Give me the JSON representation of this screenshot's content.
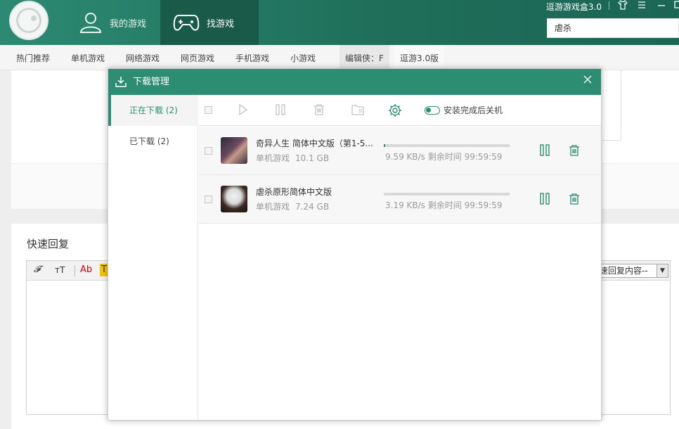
{
  "header": {
    "tabs": [
      {
        "label": "我的游戏",
        "icon": "user-icon"
      },
      {
        "label": "找游戏",
        "icon": "gamepad-icon"
      }
    ],
    "brand": "逗游游戏盒3.0",
    "search_value": "虐杀"
  },
  "subnav": {
    "items": [
      "热门推荐",
      "单机游戏",
      "网络游戏",
      "网页游戏",
      "手机游戏",
      "小游戏",
      "编辑侠：F",
      "逗游3.0版"
    ]
  },
  "page": {
    "quick_reply_title": "快速回复",
    "reply_select": "速回复内容--",
    "editor_buttons": [
      "𝓕",
      "ᴛT",
      "Ab",
      "T"
    ]
  },
  "dialog": {
    "title": "下载管理",
    "side": [
      {
        "label": "正在下载 (2)"
      },
      {
        "label": "已下载 (2)"
      }
    ],
    "toggle_label": "安装完成后关机",
    "downloads": [
      {
        "name": "奇异人生  简体中文版（第1-5...",
        "category": "单机游戏",
        "size": "10.1 GB",
        "speed": "9.59 KB/s",
        "remaining": "剩余时间 99:59:59",
        "progress": 0.01
      },
      {
        "name": "虐杀原形简体中文版",
        "category": "单机游戏",
        "size": "7.24 GB",
        "speed": "3.19 KB/s",
        "remaining": "剩余时间 99:59:59",
        "progress": 0
      }
    ]
  },
  "colors": {
    "accent": "#2c8d72",
    "header_dark": "#1a5a48"
  }
}
